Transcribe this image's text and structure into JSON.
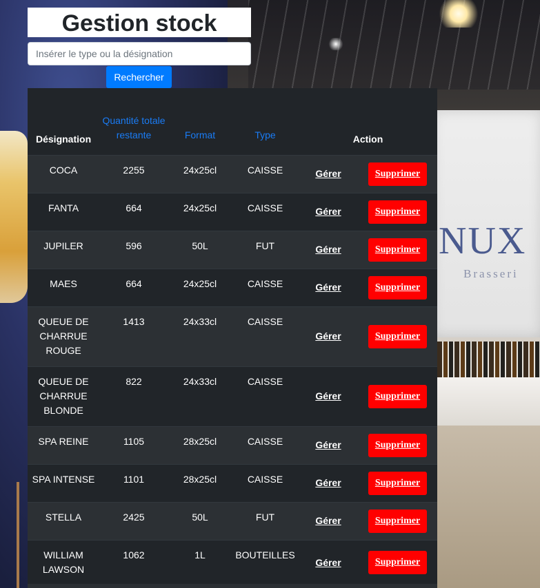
{
  "page": {
    "title": "Gestion stock",
    "search_placeholder": "Insérer le type ou la désignation",
    "search_value": "",
    "search_button": "Rechercher"
  },
  "table": {
    "headers": {
      "designation": "Désignation",
      "quantite": "Quantité totale restante",
      "format": "Format",
      "type": "Type",
      "action": "Action"
    },
    "manage_label": "Gérer",
    "delete_label": "Supprimer",
    "rows": [
      {
        "designation": "COCA",
        "quantite": "2255",
        "format": "24x25cl",
        "type": "CAISSE"
      },
      {
        "designation": "FANTA",
        "quantite": "664",
        "format": "24x25cl",
        "type": "CAISSE"
      },
      {
        "designation": "JUPILER",
        "quantite": "596",
        "format": "50L",
        "type": "FUT"
      },
      {
        "designation": "MAES",
        "quantite": "664",
        "format": "24x25cl",
        "type": "CAISSE"
      },
      {
        "designation": "QUEUE DE CHARRUE ROUGE",
        "quantite": "1413",
        "format": "24x33cl",
        "type": "CAISSE"
      },
      {
        "designation": "QUEUE DE CHARRUE BLONDE",
        "quantite": "822",
        "format": "24x33cl",
        "type": "CAISSE"
      },
      {
        "designation": "SPA REINE",
        "quantite": "1105",
        "format": "28x25cl",
        "type": "CAISSE"
      },
      {
        "designation": "SPA INTENSE",
        "quantite": "1101",
        "format": "28x25cl",
        "type": "CAISSE"
      },
      {
        "designation": "STELLA",
        "quantite": "2425",
        "format": "50L",
        "type": "FUT"
      },
      {
        "designation": "WILLIAM LAWSON",
        "quantite": "1062",
        "format": "1L",
        "type": "BOUTEILLES"
      }
    ]
  },
  "background": {
    "brand_text": "NUX",
    "brand_sub": "Brasseri"
  },
  "colors": {
    "primary_button": "#007bff",
    "delete_button": "#ff0000",
    "table_dark": "#212529",
    "table_stripe": "#2c3034",
    "header_link_blue": "#1a7cf5"
  }
}
